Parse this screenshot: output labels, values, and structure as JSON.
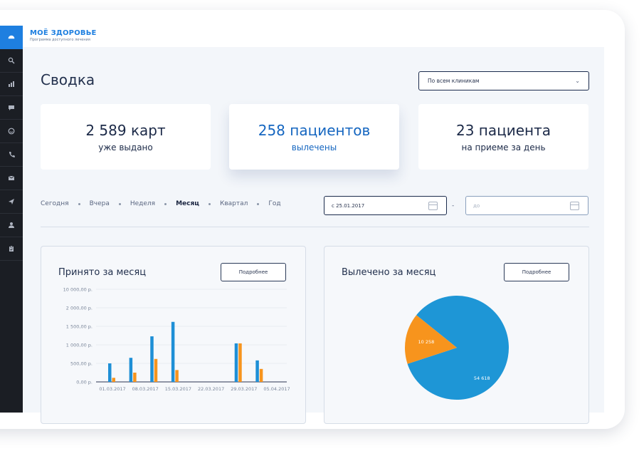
{
  "app": {
    "logo_title": "МОЁ ЗДОРОВЬЕ",
    "logo_subtitle": "Программа доступного лечения",
    "accent_color": "#1e7fe0"
  },
  "sidebar": {
    "items": [
      {
        "icon": "dashboard-icon",
        "active": true
      },
      {
        "icon": "search-icon",
        "active": false
      },
      {
        "icon": "bar-chart-icon",
        "active": false
      },
      {
        "icon": "chat-icon",
        "active": false
      },
      {
        "icon": "smile-icon",
        "active": false
      },
      {
        "icon": "phone-icon",
        "active": false
      },
      {
        "icon": "mail-icon",
        "active": false
      },
      {
        "icon": "send-icon",
        "active": false
      },
      {
        "icon": "user-icon",
        "active": false
      },
      {
        "icon": "clipboard-icon",
        "active": false
      }
    ]
  },
  "header": {
    "title": "Сводка",
    "clinic_select": "По всем клиникам"
  },
  "stats": [
    {
      "value": "2 589 карт",
      "label": "уже выдано",
      "highlight": false
    },
    {
      "value": "258 пациентов",
      "label": "вылечены",
      "highlight": true
    },
    {
      "value": "23 пациента",
      "label": "на приеме за день",
      "highlight": false
    }
  ],
  "filters": {
    "periods": [
      "Сегодня",
      "Вчера",
      "Неделя",
      "Месяц",
      "Квартал",
      "Год"
    ],
    "active_period": "Месяц",
    "date_from": "с 25.01.2017",
    "date_to_placeholder": "до"
  },
  "panels": {
    "left": {
      "title": "Принято за месяц",
      "button": "Подробнее"
    },
    "right": {
      "title": "Вылечено за месяц",
      "button": "Подробнее"
    }
  },
  "chart_data": [
    {
      "type": "bar",
      "title": "Принято за месяц",
      "y_tick_labels": [
        "0,00 р.",
        "500,00 р.",
        "1 000,00 р.",
        "1 500,00 р.",
        "2 000,00 р.",
        "10 000,00 р."
      ],
      "x_tick_labels": [
        "01.03.2017",
        "08.03.2017",
        "15.03.2017",
        "22.03.2017",
        "29.03.2017",
        "05.04.2017"
      ],
      "grid": true,
      "series": [
        {
          "color": "#1e8fd6",
          "values": [
            500,
            650,
            1230,
            1620,
            0,
            0,
            1040,
            580
          ]
        },
        {
          "color": "#f7941d",
          "values": [
            110,
            250,
            620,
            320,
            0,
            0,
            1040,
            350
          ]
        }
      ],
      "bar_week_positions": [
        0,
        1,
        2,
        3,
        4,
        5,
        6,
        7
      ]
    },
    {
      "type": "pie",
      "title": "Вылечено за месяц",
      "slices": [
        {
          "label": "54 618",
          "value": 54618,
          "color": "#1e96d6"
        },
        {
          "label": "10 258",
          "value": 10258,
          "color": "#f7941d"
        }
      ]
    }
  ]
}
